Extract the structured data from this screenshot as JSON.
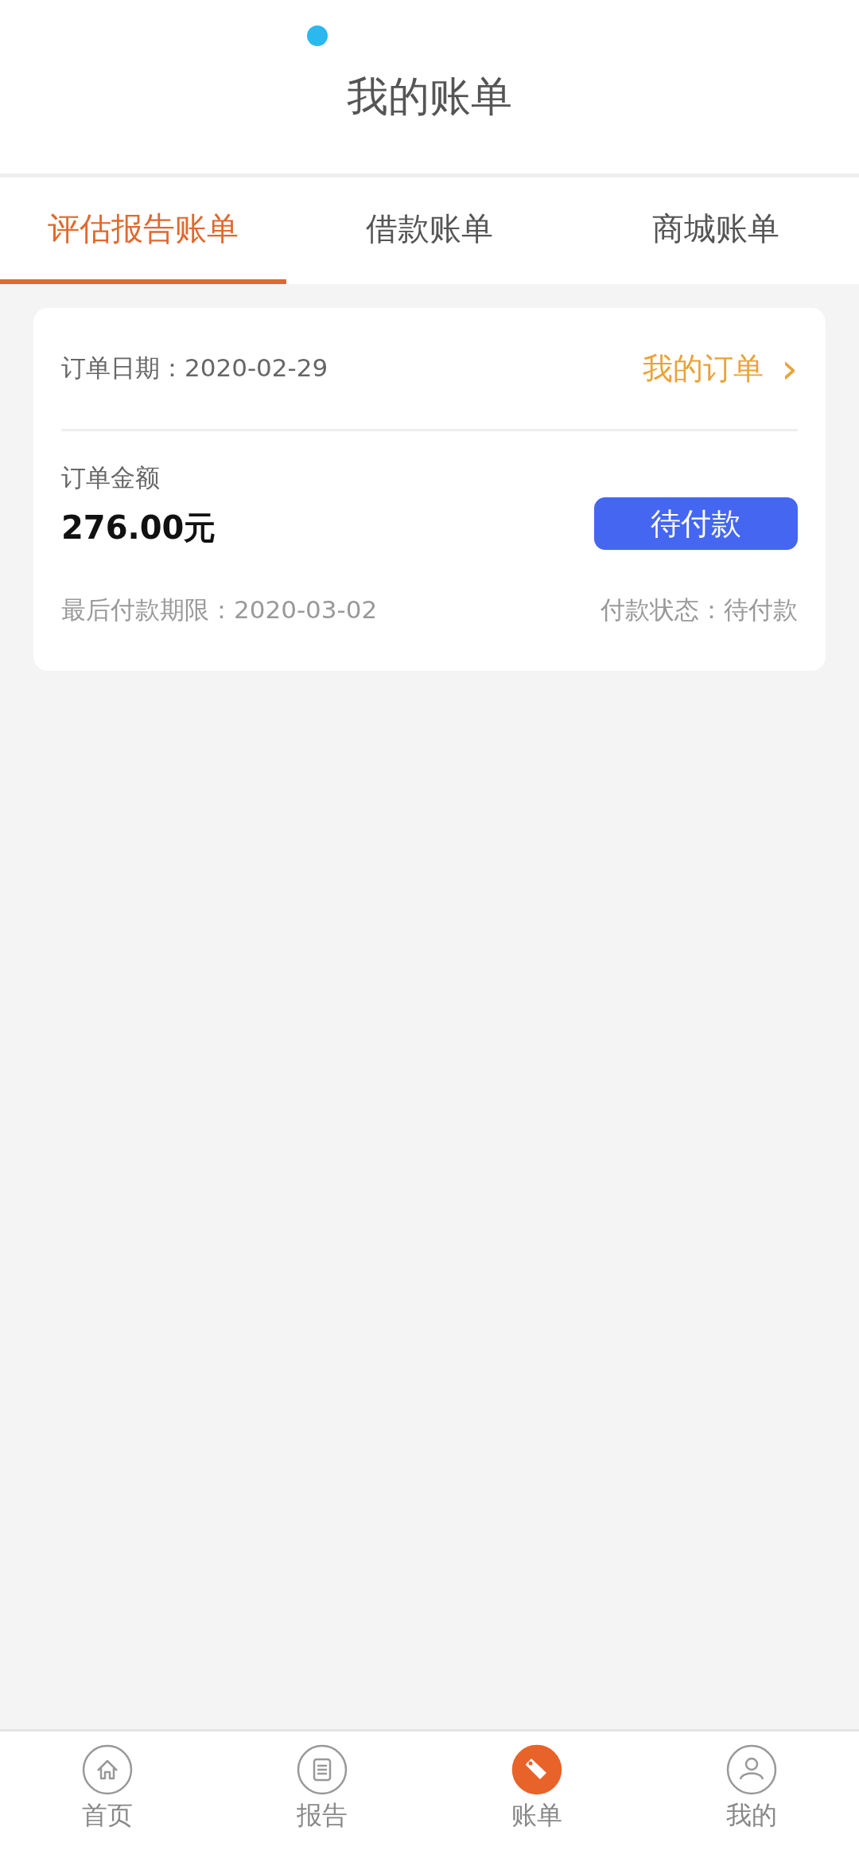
{
  "header": {
    "title": "我的账单"
  },
  "tabs": [
    {
      "label": "评估报告账单",
      "selected": true
    },
    {
      "label": "借款账单",
      "selected": false
    },
    {
      "label": "商城账单",
      "selected": false
    }
  ],
  "orders": [
    {
      "date_label": "订单日期：",
      "date": "2020-02-29",
      "link": "我的订单",
      "chevron": "›",
      "amount_label": "订单金额",
      "amount": "276.00元",
      "pay_button": "待付款",
      "deadline_label": "最后付款期限：",
      "deadline": "2020-03-02",
      "status": "付款状态：待付款"
    }
  ],
  "nav": [
    {
      "label": "首页",
      "kind": "home",
      "selected": false
    },
    {
      "label": "报告",
      "kind": "report",
      "selected": false
    },
    {
      "label": "账单",
      "kind": "bill",
      "selected": true
    },
    {
      "label": "我的",
      "kind": "profile",
      "selected": false
    }
  ]
}
